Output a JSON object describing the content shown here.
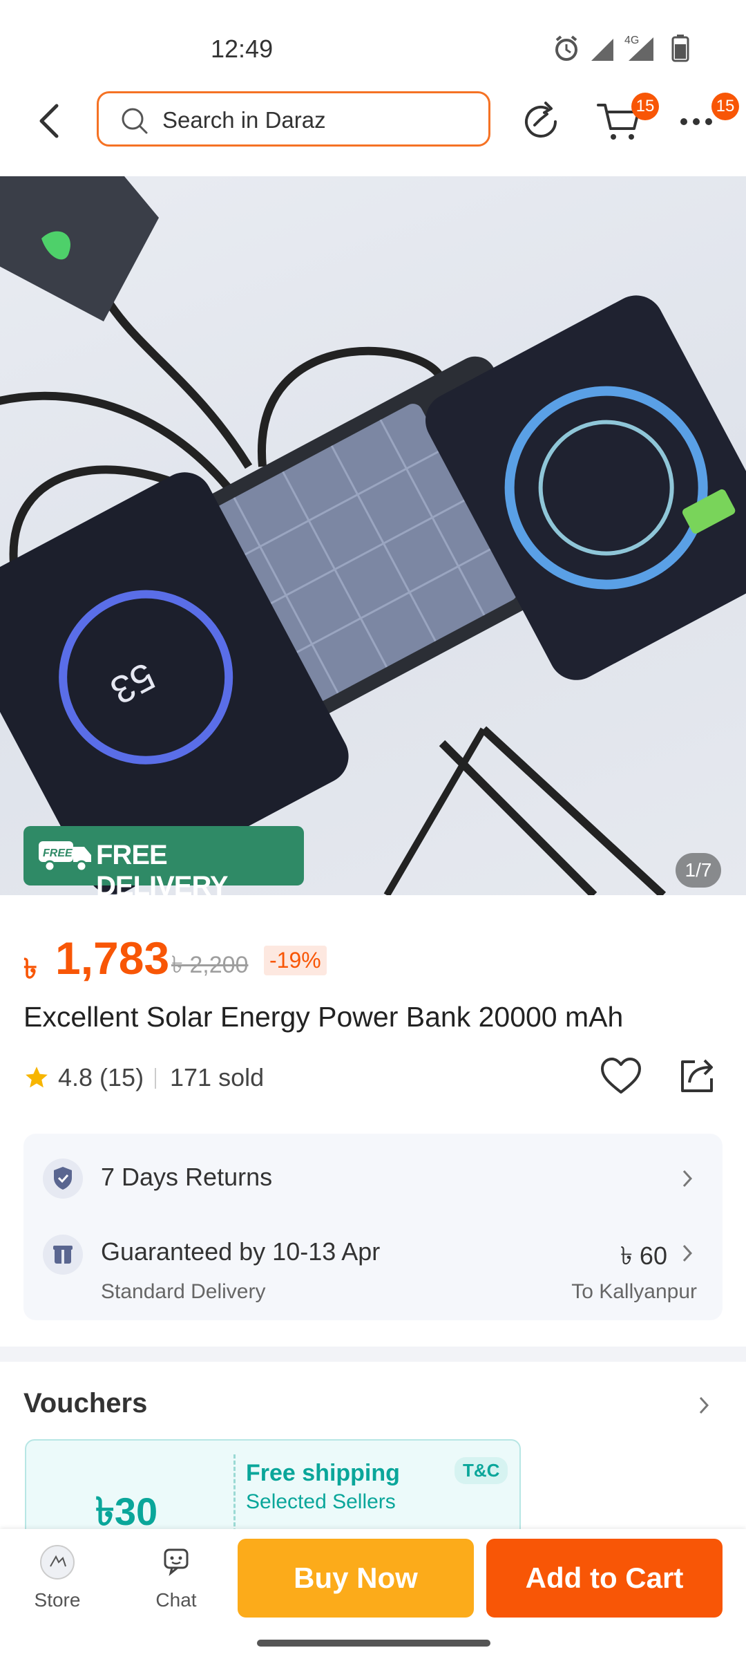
{
  "status_bar": {
    "time": "12:49",
    "network": "4G"
  },
  "header": {
    "search_placeholder": "Search in Daraz",
    "cart_count": "15",
    "more_count": "15"
  },
  "hero": {
    "badge_free": "FREE",
    "free_delivery": "FREE DELIVERY",
    "counter": "1/7"
  },
  "product": {
    "currency": "৳",
    "price": "1,783",
    "old_price": "৳ 2,200",
    "discount": "-19%",
    "title": "Excellent Solar Energy Power Bank 20000 mAh",
    "rating": "4.8 (15)",
    "sold": "171 sold"
  },
  "info": {
    "returns": "7 Days Returns",
    "delivery": "Guaranteed by 10-13 Apr",
    "delivery_type": "Standard Delivery",
    "fee": "৳ 60",
    "destination": "To Kallyanpur"
  },
  "vouchers": {
    "title": "Vouchers",
    "amount": "৳30",
    "voucher_title": "Free shipping",
    "voucher_sub": "Selected Sellers",
    "tc": "T&C"
  },
  "bottom": {
    "store": "Store",
    "chat": "Chat",
    "buy_now": "Buy Now",
    "add_to_cart": "Add to Cart"
  },
  "colors": {
    "accent": "#f85606",
    "buy": "#fcab1a",
    "free_green": "#2f8a66",
    "voucher": "#0aa69a"
  }
}
